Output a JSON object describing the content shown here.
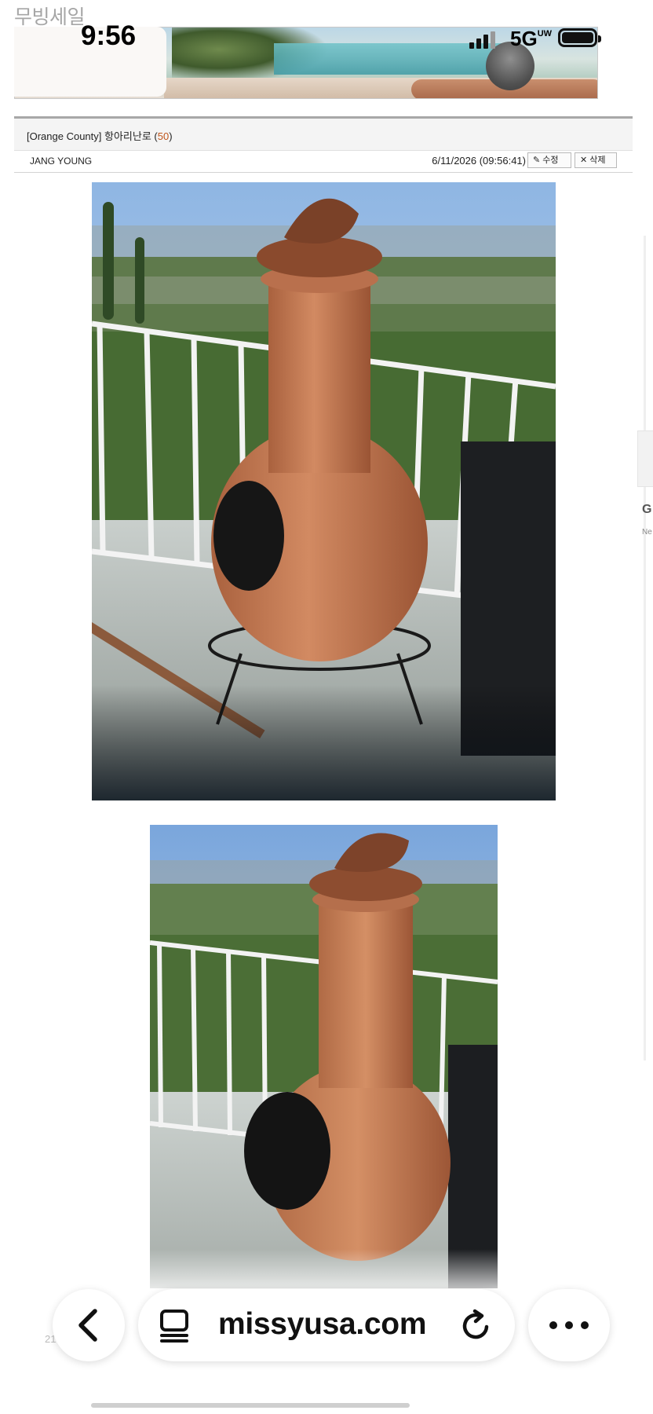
{
  "site": {
    "name": "무빙세일"
  },
  "status_bar": {
    "time": "9:56",
    "network": "5G",
    "network_badge": "UW"
  },
  "post": {
    "title_prefix": "[Orange County] 항아리난로 (",
    "reply_count": "50",
    "title_suffix": ")",
    "author": "JANG YOUNG",
    "date": "6/11/2026 (09:56:41)",
    "edit_label": "수정",
    "delete_label": "삭제"
  },
  "side_glimpse": {
    "letter": "G",
    "sub": "Ne"
  },
  "footer": {
    "page_number": "21"
  },
  "browser": {
    "url": "missyusa.com",
    "icons": [
      "back-chevron-icon",
      "reader-mode-icon",
      "reload-icon",
      "more-dots-icon"
    ]
  }
}
